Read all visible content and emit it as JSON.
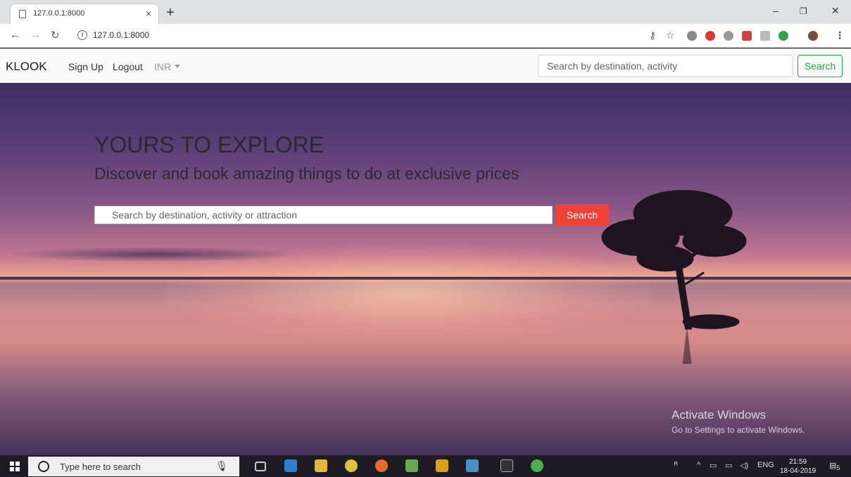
{
  "browser": {
    "tab_title": "127.0.0.1:8000",
    "tab_close": "×",
    "new_tab": "+",
    "url": "127.0.0.1:8000",
    "window_controls": {
      "minimize": "–",
      "restore": "❐",
      "close": "✕"
    }
  },
  "site": {
    "brand": "KLOOK",
    "nav": {
      "signup": "Sign Up",
      "logout": "Logout",
      "currency": "INR"
    },
    "nav_search": {
      "placeholder": "Search by destination, activity",
      "button": "Search"
    }
  },
  "hero": {
    "title": "YOURS TO EXPLORE",
    "subtitle": "Discover and book amazing things to do at exclusive prices",
    "search_placeholder": "Search by destination, activity or attraction",
    "search_button": "Search",
    "accent_color": "#f04137"
  },
  "watermark": {
    "line1": "Activate Windows",
    "line2": "Go to Settings to activate Windows."
  },
  "taskbar": {
    "search_placeholder": "Type here to search",
    "language": "ENG",
    "time": "21:59",
    "date": "18-04-2019",
    "notification_count": "5"
  }
}
